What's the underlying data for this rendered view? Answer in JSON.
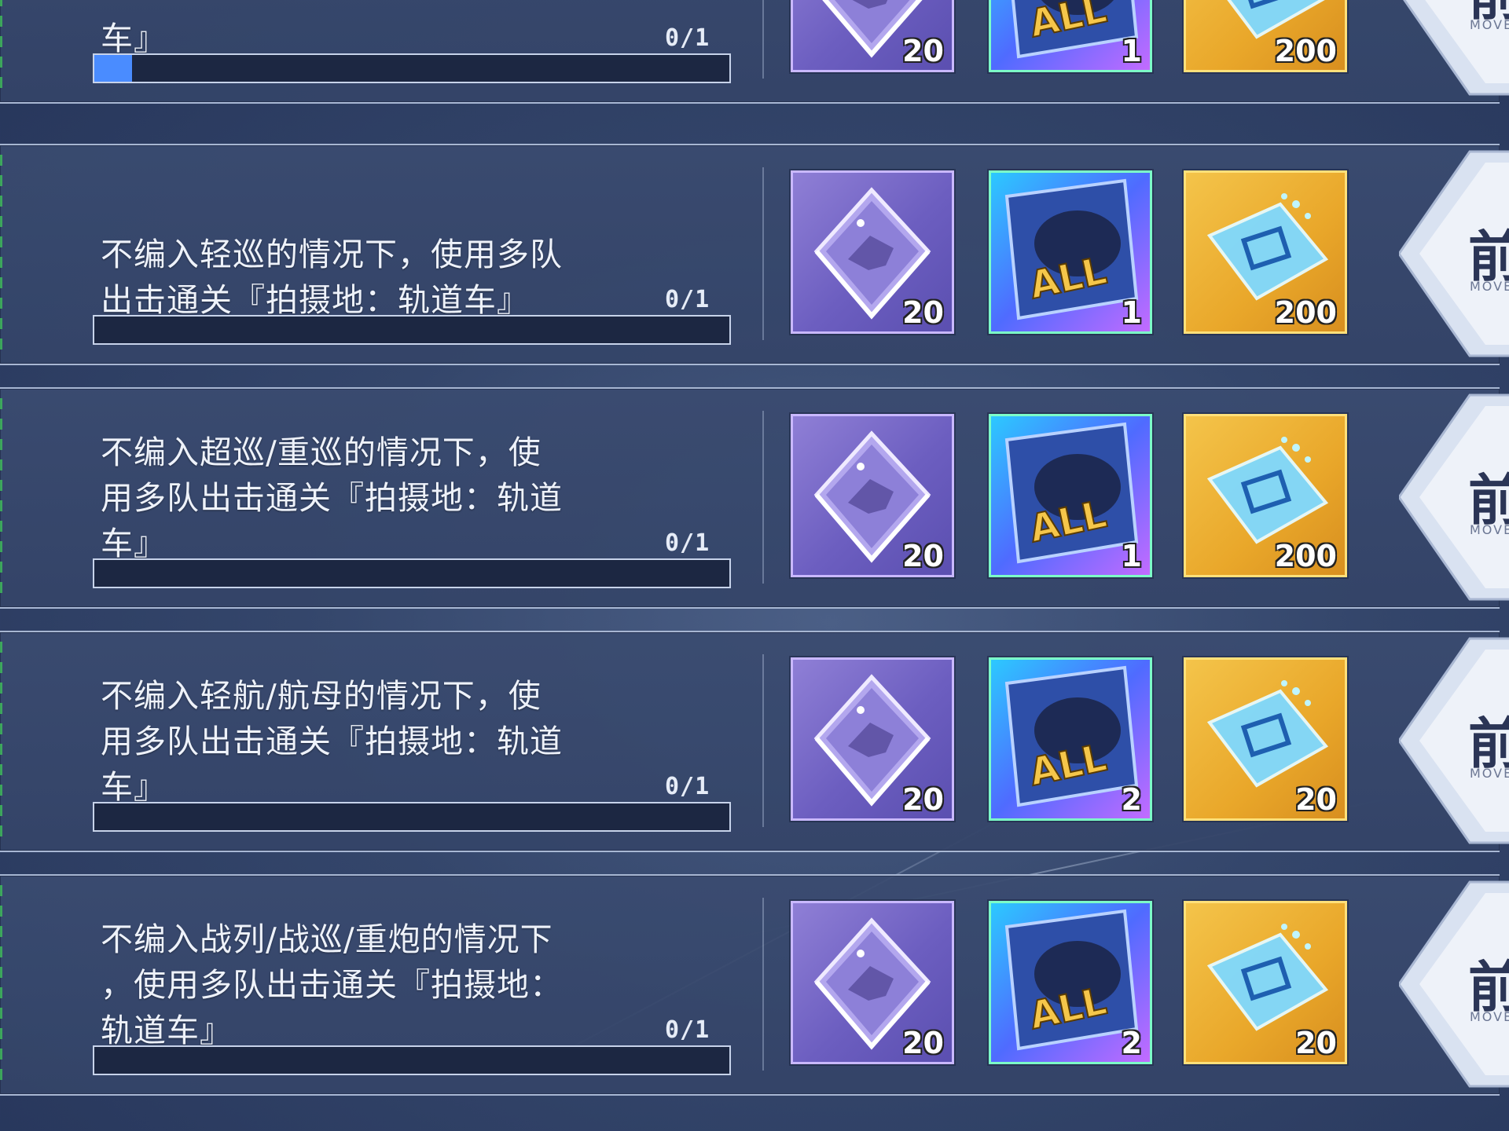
{
  "tasks": [
    {
      "description": "车』",
      "progress": "0/1",
      "progress_value": 0.06,
      "rewards": [
        {
          "type": "equipment-box",
          "quantity": "20"
        },
        {
          "type": "all-ticket",
          "quantity": "1"
        },
        {
          "type": "data-chip",
          "quantity": "200"
        }
      ],
      "action_label": "前",
      "action_sub": "MOVE"
    },
    {
      "description": "不编入轻巡的情况下，使用多队\n出击通关『拍摄地：轨道车』",
      "progress": "0/1",
      "progress_value": 0,
      "rewards": [
        {
          "type": "equipment-box",
          "quantity": "20"
        },
        {
          "type": "all-ticket",
          "quantity": "1"
        },
        {
          "type": "data-chip",
          "quantity": "200"
        }
      ],
      "action_label": "前",
      "action_sub": "MOVE"
    },
    {
      "description": "不编入超巡/重巡的情况下，使\n用多队出击通关『拍摄地：轨道\n车』",
      "progress": "0/1",
      "progress_value": 0,
      "rewards": [
        {
          "type": "equipment-box",
          "quantity": "20"
        },
        {
          "type": "all-ticket",
          "quantity": "1"
        },
        {
          "type": "data-chip",
          "quantity": "200"
        }
      ],
      "action_label": "前",
      "action_sub": "MOVE"
    },
    {
      "description": "不编入轻航/航母的情况下，使\n用多队出击通关『拍摄地：轨道\n车』",
      "progress": "0/1",
      "progress_value": 0,
      "rewards": [
        {
          "type": "equipment-box",
          "quantity": "20"
        },
        {
          "type": "all-ticket",
          "quantity": "2"
        },
        {
          "type": "data-chip",
          "quantity": "20"
        }
      ],
      "action_label": "前",
      "action_sub": "MOVE"
    },
    {
      "description": "不编入战列/战巡/重炮的情况下\n，使用多队出击通关『拍摄地：\n轨道车』",
      "progress": "0/1",
      "progress_value": 0,
      "rewards": [
        {
          "type": "equipment-box",
          "quantity": "20"
        },
        {
          "type": "all-ticket",
          "quantity": "2"
        },
        {
          "type": "data-chip",
          "quantity": "20"
        }
      ],
      "action_label": "前",
      "action_sub": "MOVE"
    }
  ]
}
